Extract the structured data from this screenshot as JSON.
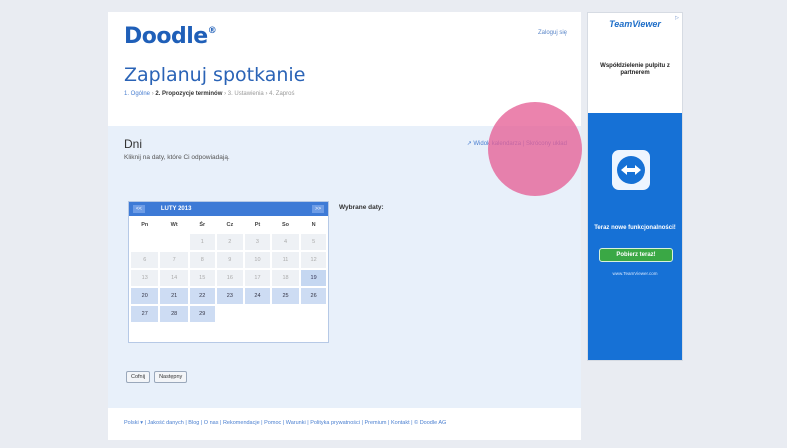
{
  "app": {
    "logo": "Doodle",
    "logo_mark": "®",
    "login_link": "Zaloguj się",
    "page_title": "Zaplanuj spotkanie",
    "steps": [
      {
        "label": "1. Ogólne",
        "sep": " › ",
        "state": "done"
      },
      {
        "label": "2. Propozycje terminów",
        "sep": " › ",
        "state": "current"
      },
      {
        "label": "3. Ustawienia",
        "sep": " › ",
        "state": "todo"
      },
      {
        "label": "4. Zaproś",
        "sep": "",
        "state": "todo"
      }
    ]
  },
  "panel": {
    "title": "Dni",
    "subtitle": "Kliknij na daty, które Ci odpowiadają.",
    "links": "↗ Widok kalendarza | Skrócony układ",
    "selected_label": "Wybrane daty:"
  },
  "calendar": {
    "prev": "<<",
    "next": ">>",
    "month": "LUTY 2013",
    "weekdays": [
      "Pn",
      "Wt",
      "Śr",
      "Cz",
      "Pt",
      "So",
      "N"
    ],
    "weeks": [
      [
        "",
        "",
        "1",
        "2",
        "3",
        "4",
        "5"
      ],
      [
        "6",
        "7",
        "8",
        "9",
        "10",
        "11",
        "12"
      ],
      [
        "13",
        "14",
        "15",
        "16",
        "17",
        "18",
        "19"
      ],
      [
        "20",
        "21",
        "22",
        "23",
        "24",
        "25",
        "26"
      ],
      [
        "27",
        "28",
        "29",
        "",
        "",
        "",
        ""
      ]
    ],
    "today": "19"
  },
  "buttons": {
    "back": "Cofnij",
    "next": "Następny"
  },
  "footer": {
    "text": "Polski ▾ | Jakość danych | Blog | O nas | Rekomendacje | Pomoc | Warunki | Polityka prywatności | Premium | Kontakt | © Doodle AG"
  },
  "ad": {
    "close": "▷",
    "logo": "TeamViewer",
    "headline": "Współdzielenie pulpitu z partnerem",
    "promo": "Teraz nowe funkcjonalności!",
    "button": "Pobierz teraz!",
    "url": "www.TeamViewer.com"
  }
}
